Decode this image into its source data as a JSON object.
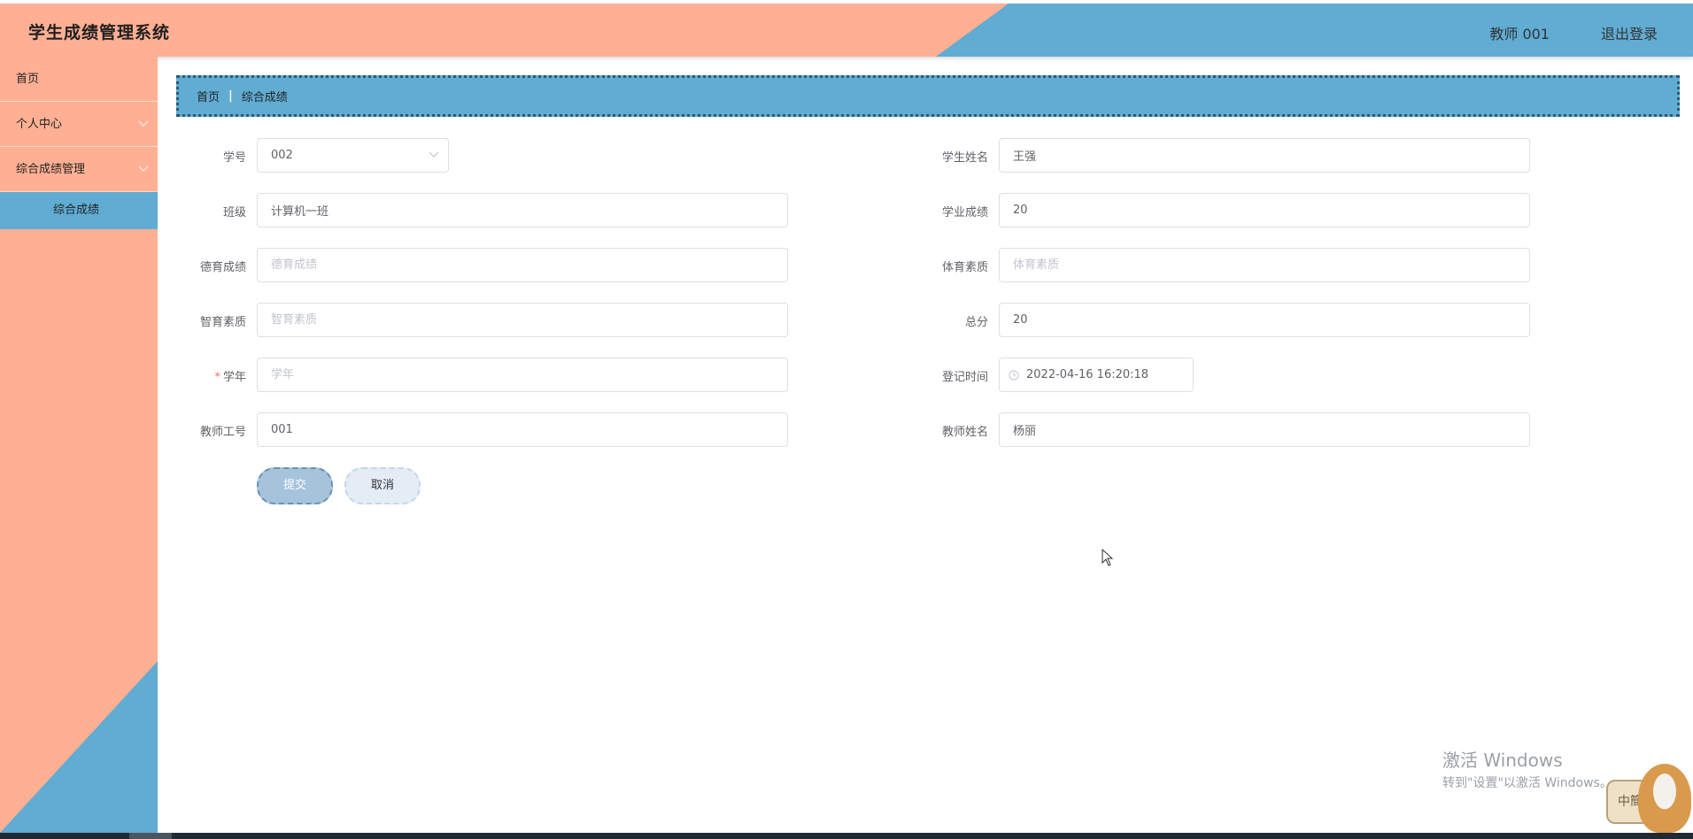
{
  "header": {
    "app_title": "学生成绩管理系统",
    "user_label": "教师 001",
    "logout_label": "退出登录"
  },
  "sidebar": {
    "items": [
      {
        "label": "首页"
      },
      {
        "label": "个人中心"
      },
      {
        "label": "综合成绩管理"
      }
    ],
    "sub_items": [
      {
        "label": "综合成绩"
      }
    ]
  },
  "breadcrumb": {
    "home": "首页",
    "separator": "|",
    "current": "综合成绩"
  },
  "form": {
    "student_id": {
      "label": "学号",
      "value": "002"
    },
    "student_name": {
      "label": "学生姓名",
      "value": "王强"
    },
    "class_name": {
      "label": "班级",
      "value": "计算机一班"
    },
    "academic_score": {
      "label": "学业成绩",
      "value": "20"
    },
    "moral_score": {
      "label": "德育成绩",
      "placeholder": "德育成绩"
    },
    "physical_quality": {
      "label": "体育素质",
      "placeholder": "体育素质"
    },
    "intellectual_quality": {
      "label": "智育素质",
      "placeholder": "智育素质"
    },
    "total_score": {
      "label": "总分",
      "value": "20"
    },
    "school_year": {
      "label": "学年",
      "required_mark": "*",
      "placeholder": "学年"
    },
    "register_time": {
      "label": "登记时间",
      "value": "2022-04-16 16:20:18"
    },
    "teacher_id": {
      "label": "教师工号",
      "value": "001"
    },
    "teacher_name": {
      "label": "教师姓名",
      "value": "杨丽"
    }
  },
  "buttons": {
    "submit": "提交",
    "cancel": "取消"
  },
  "watermark": {
    "line1": "激活 Windows",
    "line2": "转到\"设置\"以激活 Windows。"
  },
  "ime": {
    "label": "中簡"
  },
  "colors": {
    "salmon": "#ffb094",
    "blue": "#60acd3",
    "required": "#f56c6c"
  }
}
